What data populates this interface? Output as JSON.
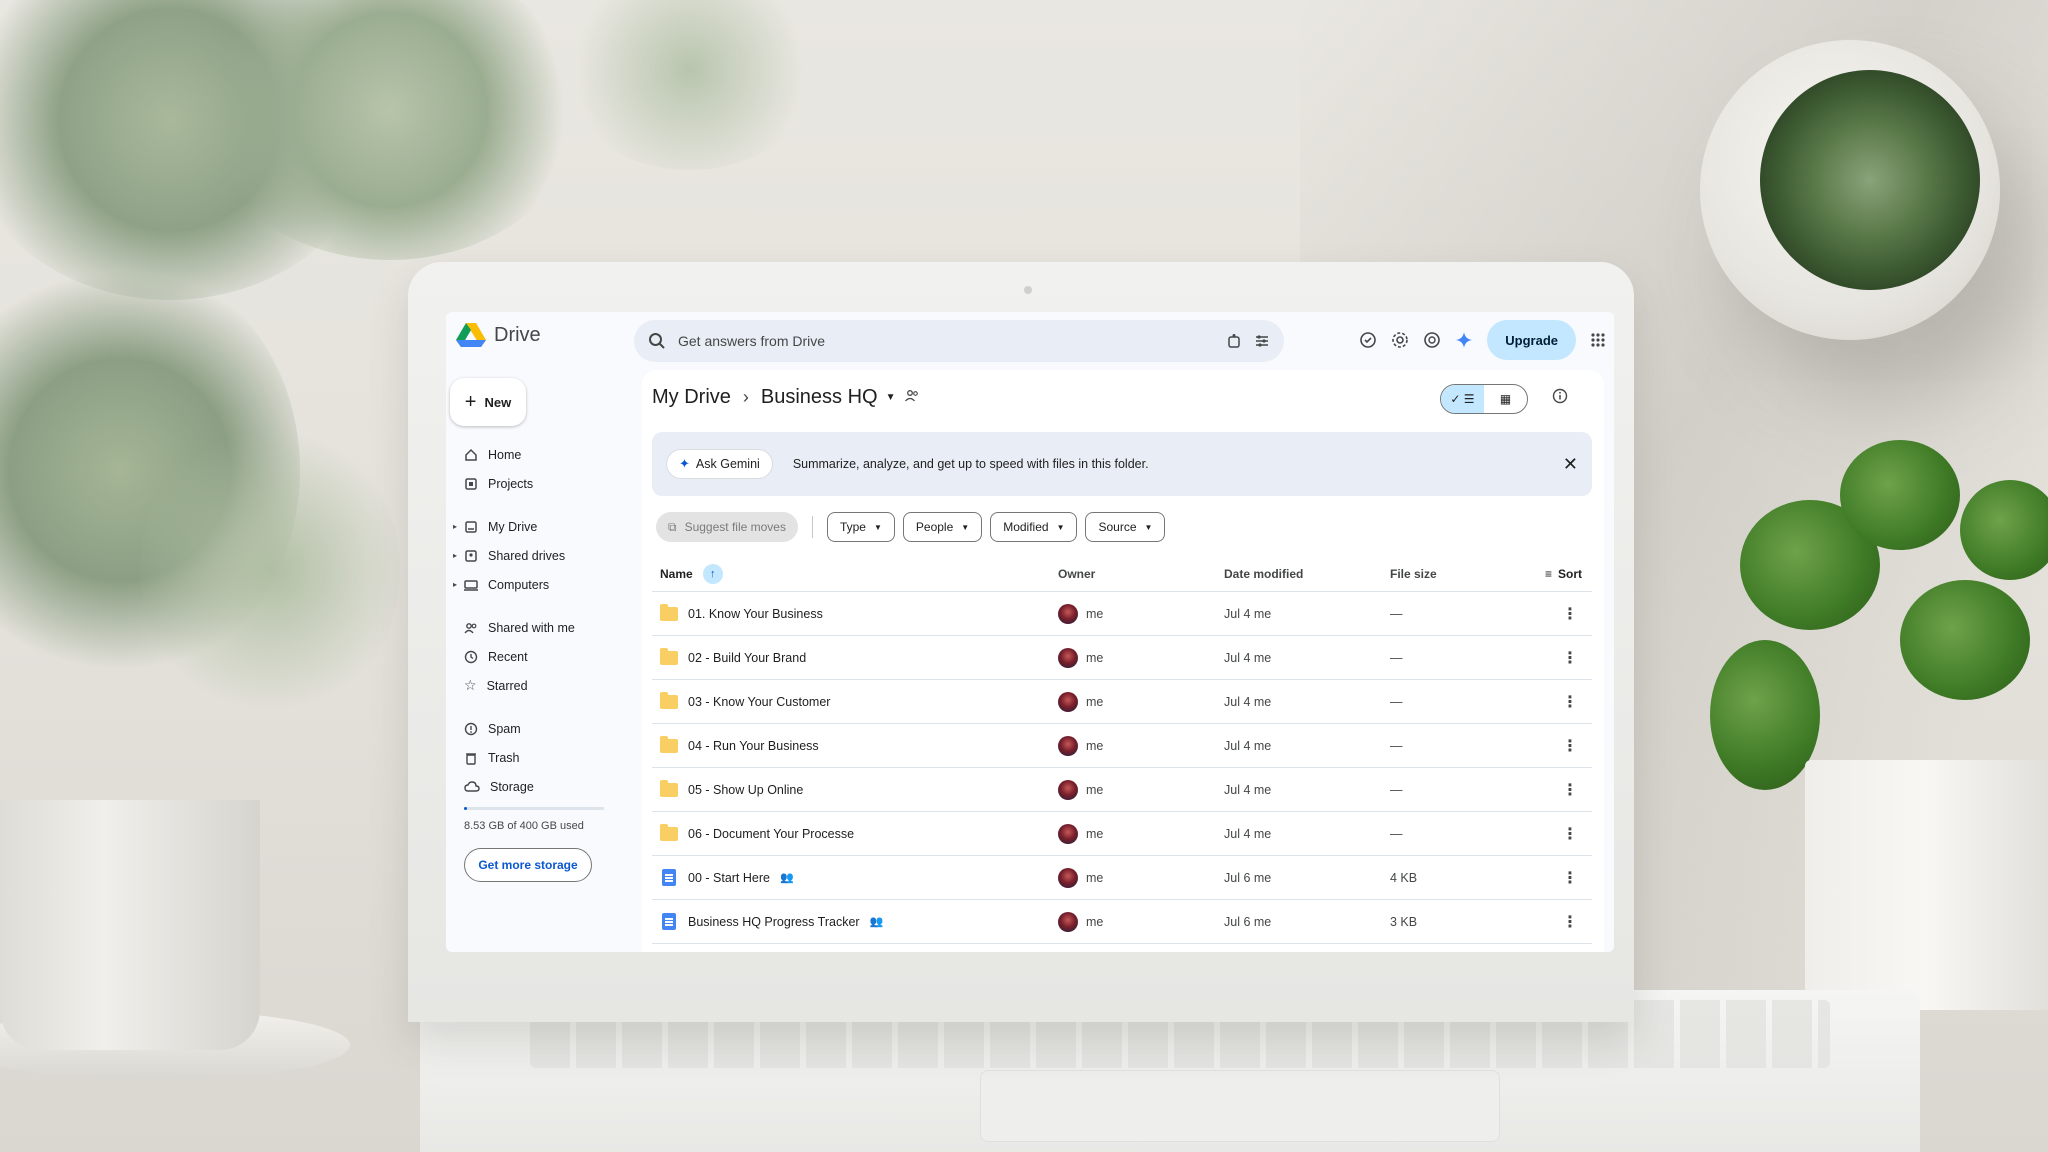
{
  "app": {
    "name": "Drive",
    "search_placeholder": "Get answers from Drive",
    "upgrade_label": "Upgrade",
    "accent": "#0b57d0",
    "chip_blue": "#c2e7ff",
    "folder_color": "#f9cf63",
    "doc_color": "#4285f4"
  },
  "sidebar": {
    "new_label": "New",
    "items": [
      {
        "label": "Home",
        "icon": "home-icon"
      },
      {
        "label": "Projects",
        "icon": "projects-icon"
      },
      {
        "label": "My Drive",
        "icon": "my-drive-icon",
        "expandable": true
      },
      {
        "label": "Shared drives",
        "icon": "shared-drives-icon",
        "expandable": true
      },
      {
        "label": "Computers",
        "icon": "computers-icon",
        "expandable": true
      },
      {
        "label": "Shared with me",
        "icon": "people-icon"
      },
      {
        "label": "Recent",
        "icon": "clock-icon"
      },
      {
        "label": "Starred",
        "icon": "star-icon"
      },
      {
        "label": "Spam",
        "icon": "spam-icon"
      },
      {
        "label": "Trash",
        "icon": "trash-icon"
      },
      {
        "label": "Storage",
        "icon": "cloud-icon"
      }
    ],
    "storage_used_fraction": 0.02,
    "storage_text": "8.53 GB of 400 GB used",
    "get_storage_label": "Get more storage"
  },
  "breadcrumb": {
    "root": "My Drive",
    "sep": "›",
    "current": "Business HQ"
  },
  "gemini": {
    "button_label": "Ask Gemini",
    "text": "Summarize, analyze, and get up to speed with files in this folder."
  },
  "filters": {
    "suggest_label": "Suggest file moves",
    "chips": [
      "Type",
      "People",
      "Modified",
      "Source"
    ]
  },
  "table": {
    "headers": {
      "name": "Name",
      "owner": "Owner",
      "date": "Date modified",
      "size": "File size",
      "sort": "Sort"
    },
    "rows": [
      {
        "name": "01. Know Your Business",
        "kind": "folder",
        "owner": "me",
        "date": "Jul 4 me",
        "size": "—",
        "shared": false
      },
      {
        "name": "02 - Build Your Brand",
        "kind": "folder",
        "owner": "me",
        "date": "Jul 4 me",
        "size": "—",
        "shared": false
      },
      {
        "name": "03 - Know Your Customer",
        "kind": "folder",
        "owner": "me",
        "date": "Jul 4 me",
        "size": "—",
        "shared": false
      },
      {
        "name": "04 - Run Your Business",
        "kind": "folder",
        "owner": "me",
        "date": "Jul 4 me",
        "size": "—",
        "shared": false
      },
      {
        "name": "05 - Show Up Online",
        "kind": "folder",
        "owner": "me",
        "date": "Jul 4 me",
        "size": "—",
        "shared": false
      },
      {
        "name": "06 - Document Your Processe",
        "kind": "folder",
        "owner": "me",
        "date": "Jul 4 me",
        "size": "—",
        "shared": false
      },
      {
        "name": "00 - Start Here",
        "kind": "doc",
        "owner": "me",
        "date": "Jul 6 me",
        "size": "4 KB",
        "shared": true
      },
      {
        "name": "Business HQ Progress Tracker",
        "kind": "doc",
        "owner": "me",
        "date": "Jul 6 me",
        "size": "3 KB",
        "shared": true
      }
    ]
  }
}
